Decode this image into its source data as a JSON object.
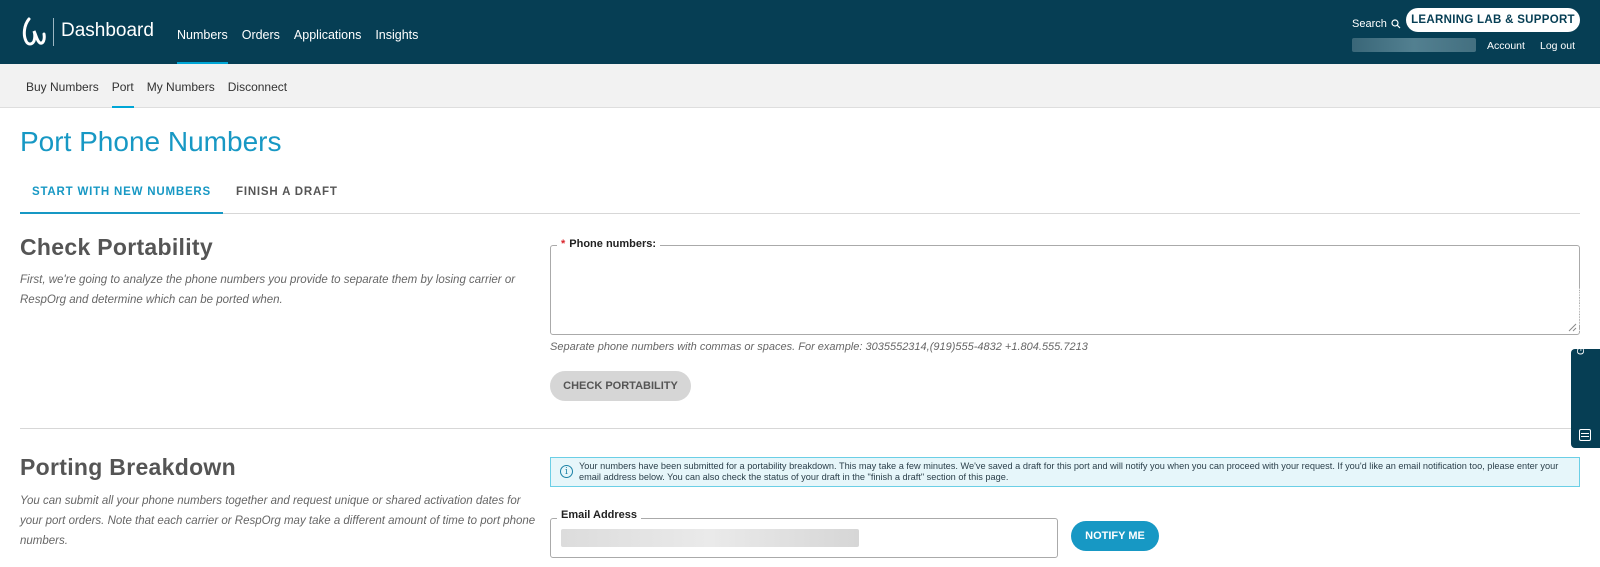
{
  "header": {
    "brand": "Dashboard",
    "nav": [
      "Numbers",
      "Orders",
      "Applications",
      "Insights"
    ],
    "active_nav": "Numbers",
    "search_label": "Search",
    "learning_button": "LEARNING LAB & SUPPORT",
    "account_link": "Account",
    "logout_link": "Log out"
  },
  "subnav": {
    "items": [
      "Buy Numbers",
      "Port",
      "My Numbers",
      "Disconnect"
    ],
    "active": "Port"
  },
  "page": {
    "title": "Port Phone Numbers",
    "tabs": [
      "START WITH NEW NUMBERS",
      "FINISH A DRAFT"
    ],
    "active_tab": "START WITH NEW NUMBERS"
  },
  "check_portability": {
    "title": "Check Portability",
    "description": "First, we're going to analyze the phone numbers you provide to separate them by losing carrier or RespOrg and determine which can be ported when.",
    "field_label": "Phone numbers:",
    "field_required_mark": "*",
    "field_value": "",
    "hint": "Separate phone numbers with commas or spaces. For example: 3035552314,(919)555-4832 +1.804.555.7213",
    "button": "CHECK PORTABILITY"
  },
  "porting_breakdown": {
    "title": "Porting Breakdown",
    "description": "You can submit all your phone numbers together and request unique or shared activation dates for your port orders. Note that each carrier or RespOrg may take a different amount of time to port phone numbers.",
    "info_message": "Your numbers have been submitted for a portability breakdown. This may take a few minutes. We've saved a draft for this port and will notify you when you can proceed with your request. If you'd like an email notification too, please enter your email address below. You can also check the status of your draft in the \"finish a draft\" section of this page.",
    "email_label": "Email Address",
    "notify_button": "NOTIFY ME"
  },
  "feedback": {
    "label": "Give Feedback"
  },
  "colors": {
    "header_bg": "#063e54",
    "accent": "#1798c4",
    "info_bg": "#e6f6fa",
    "info_border": "#6bcfe6"
  }
}
